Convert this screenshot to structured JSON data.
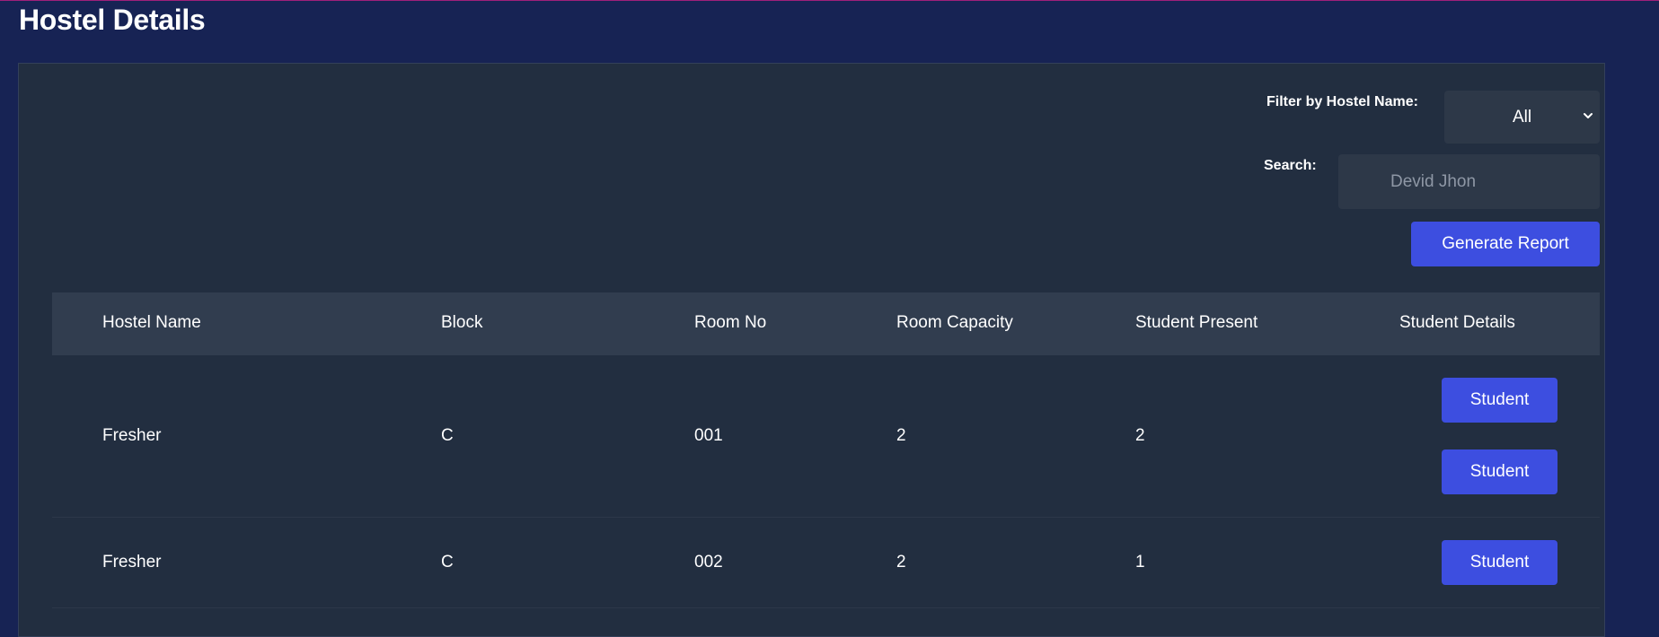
{
  "page": {
    "title": "Hostel Details"
  },
  "filters": {
    "hostel_label": "Filter by Hostel Name:",
    "hostel_selected": "All",
    "hostel_options": [
      "All"
    ],
    "search_label": "Search:",
    "search_placeholder": "Devid Jhon",
    "search_value": ""
  },
  "actions": {
    "generate_report": "Generate Report"
  },
  "table": {
    "columns": [
      "Hostel Name",
      "Block",
      "Room No",
      "Room Capacity",
      "Student Present",
      "Student Details"
    ],
    "rows": [
      {
        "hostel_name": "Fresher",
        "block": "C",
        "room_no": "001",
        "room_capacity": "2",
        "student_present": "2",
        "student_buttons": [
          "Student",
          "Student"
        ]
      },
      {
        "hostel_name": "Fresher",
        "block": "C",
        "room_no": "002",
        "room_capacity": "2",
        "student_present": "1",
        "student_buttons": [
          "Student"
        ]
      }
    ]
  },
  "colors": {
    "page_background": "#172354",
    "card_background": "#222e40",
    "header_background": "#313d4f",
    "input_background": "#2d3848",
    "accent": "#3d4ee0",
    "top_border": "#a0207a"
  },
  "icons": {
    "select_chevron": "chevron-down-icon"
  }
}
